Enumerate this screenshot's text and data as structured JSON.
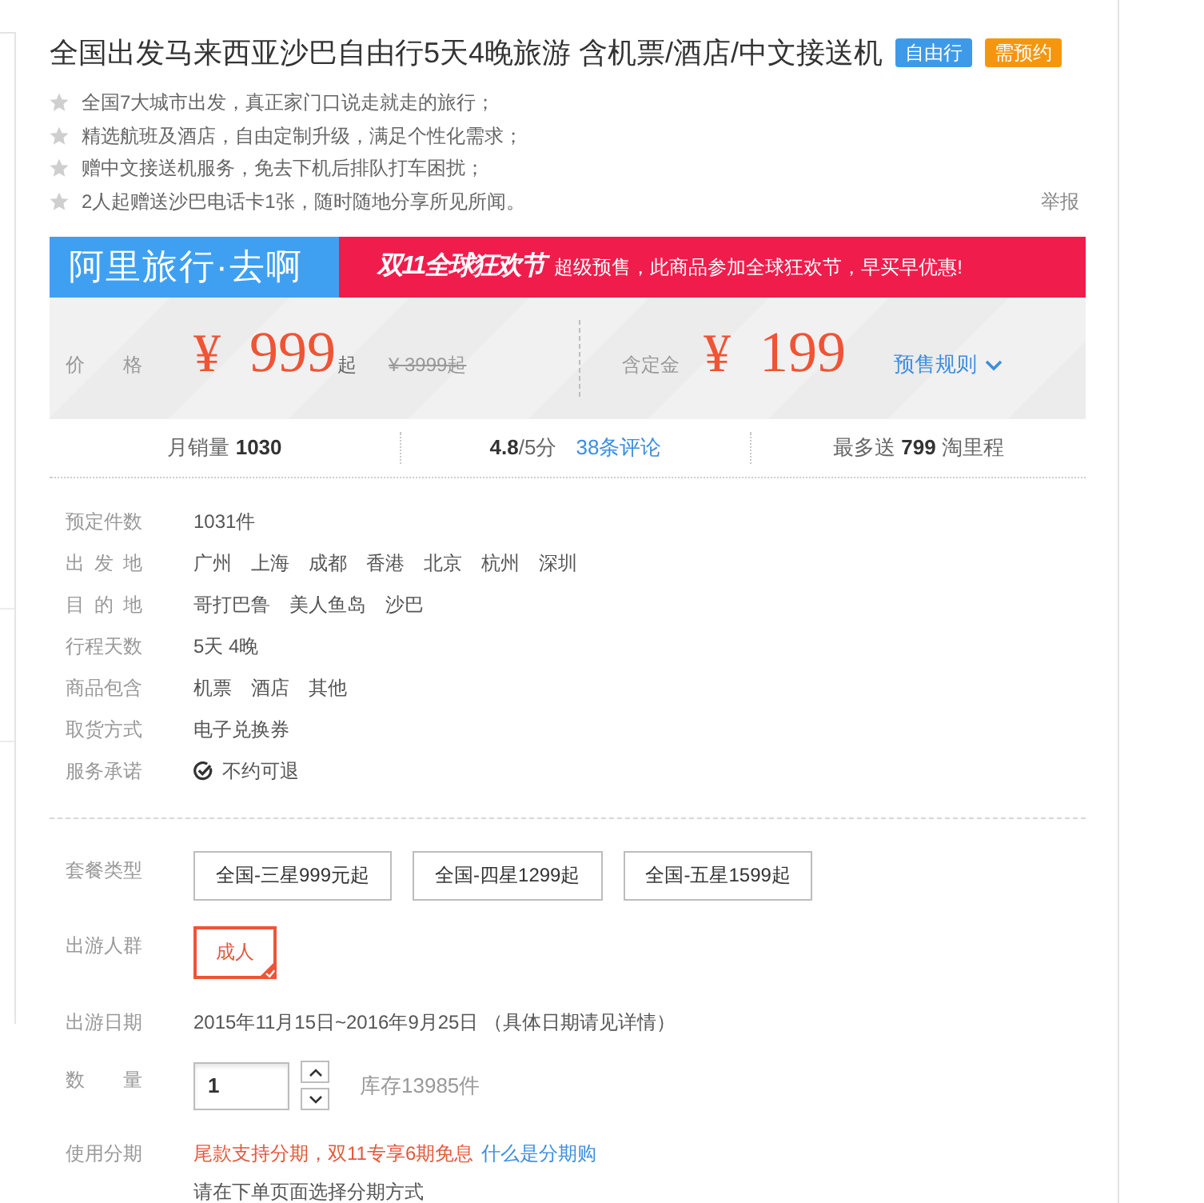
{
  "title": "全国出发马来西亚沙巴自由行5天4晚旅游 含机票/酒店/中文接送机",
  "tags": [
    {
      "label": "自由行",
      "color": "#3d9ae8"
    },
    {
      "label": "需预约",
      "color": "#f5960f"
    }
  ],
  "highlights": [
    "全国7大城市出发，真正家门口说走就走的旅行；",
    "精选航班及酒店，自由定制升级，满足个性化需求；",
    "赠中文接送机服务，免去下机后排队打车困扰；",
    "2人起赠送沙巴电话卡1张，随时随地分享所见所闻。"
  ],
  "report_link": "举报",
  "banner": {
    "brand": "阿里旅行·去啊",
    "promo_logo": "双11全球狂欢节",
    "promo_text": "超级预售，此商品参加全球狂欢节，早买早优惠!"
  },
  "price": {
    "label": "价 格",
    "currency": "¥",
    "amount": "999",
    "suffix": "起",
    "original": "¥ 3999起",
    "deposit_label": "含定金",
    "deposit_currency": "¥",
    "deposit_amount": "199",
    "rules_link": "预售规则"
  },
  "stats": {
    "sales": "月销量 **1030**",
    "rating": "**4.8**/5分",
    "reviews_link": "38条评论",
    "points": "最多送 **799** 淘里程"
  },
  "details": [
    {
      "label": "预定件数",
      "kind": "text",
      "values": [
        "1031件"
      ]
    },
    {
      "label": "出 发 地",
      "kind": "text",
      "values": [
        "广州",
        "上海",
        "成都",
        "香港",
        "北京",
        "杭州",
        "深圳"
      ]
    },
    {
      "label": "目 的 地",
      "kind": "text",
      "values": [
        "哥打巴鲁",
        "美人鱼岛",
        "沙巴"
      ]
    },
    {
      "label": "行程天数",
      "kind": "text",
      "values": [
        "5天 4晚"
      ]
    },
    {
      "label": "商品包含",
      "kind": "text",
      "values": [
        "机票",
        "酒店",
        "其他"
      ]
    },
    {
      "label": "取货方式",
      "kind": "text",
      "values": [
        "电子兑换券"
      ]
    },
    {
      "label": "服务承诺",
      "kind": "guarantee",
      "values": [
        "不约可退"
      ]
    }
  ],
  "options": [
    {
      "label": "套餐类型",
      "kind": "choices",
      "choices": [
        {
          "label": "全国-三星999元起",
          "selected": false
        },
        {
          "label": "全国-四星1299起",
          "selected": false
        },
        {
          "label": "全国-五星1599起",
          "selected": false
        }
      ]
    },
    {
      "label": "出游人群",
      "kind": "choices",
      "choices": [
        {
          "label": "成人",
          "selected": true
        }
      ]
    },
    {
      "label": "出游日期",
      "kind": "text",
      "value": "2015年11月15日~2016年9月25日 （具体日期请见详情）"
    },
    {
      "label": "数 量",
      "kind": "quantity",
      "value": "1",
      "stock": "库存13985件"
    },
    {
      "label": "使用分期",
      "kind": "installment",
      "note": "尾款支持分期，双11专享6期免息",
      "link": "什么是分期购",
      "hint": "请在下单页面选择分期方式"
    }
  ]
}
